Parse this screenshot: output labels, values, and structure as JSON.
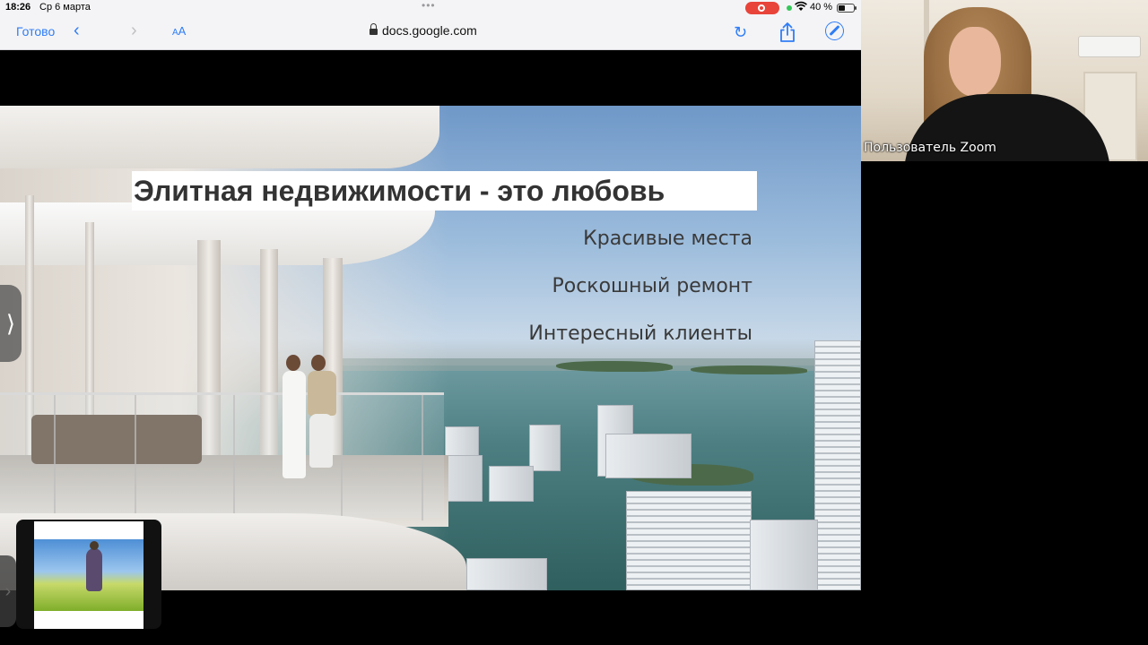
{
  "status_bar": {
    "time": "18:26",
    "date": "Ср 6 марта",
    "battery_pct": "40 %"
  },
  "browser": {
    "done_label": "Готово",
    "text_size_label": "AA",
    "url": "docs.google.com",
    "accent_color": "#2f7df6"
  },
  "slide": {
    "title": "Элитная недвижимости - это любовь",
    "bullets": [
      "Красивые места",
      "Роскошный ремонт",
      "Интересный клиенты"
    ]
  },
  "zoom": {
    "participant_name": "Пользователь Zoom"
  }
}
